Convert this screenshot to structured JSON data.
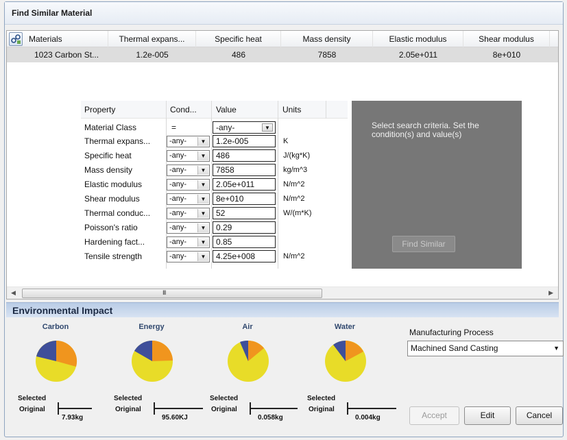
{
  "window": {
    "title": "Find Similar Material"
  },
  "grid": {
    "headers": [
      "Materials",
      "Thermal expans...",
      "Specific heat",
      "Mass density",
      "Elastic modulus",
      "Shear modulus"
    ],
    "row": [
      "1023 Carbon St...",
      "1.2e-005",
      "486",
      "7858",
      "2.05e+011",
      "8e+010"
    ]
  },
  "criteria": {
    "headers": {
      "property": "Property",
      "condition": "Cond...",
      "value": "Value",
      "units": "Units"
    },
    "material_class": {
      "name": "Material Class",
      "condition": "=",
      "value": "-any-"
    },
    "rows": [
      {
        "name": "Thermal expans...",
        "condition": "-any-",
        "value": "1.2e-005",
        "unit": "K"
      },
      {
        "name": "Specific heat",
        "condition": "-any-",
        "value": "486",
        "unit": "J/(kg*K)"
      },
      {
        "name": "Mass density",
        "condition": "-any-",
        "value": "7858",
        "unit": "kg/m^3"
      },
      {
        "name": "Elastic modulus",
        "condition": "-any-",
        "value": "2.05e+011",
        "unit": "N/m^2"
      },
      {
        "name": "Shear modulus",
        "condition": "-any-",
        "value": "8e+010",
        "unit": "N/m^2"
      },
      {
        "name": "Thermal conduc...",
        "condition": "-any-",
        "value": "52",
        "unit": "W/(m*K)"
      },
      {
        "name": "Poisson's ratio",
        "condition": "-any-",
        "value": "0.29",
        "unit": ""
      },
      {
        "name": "Hardening fact...",
        "condition": "-any-",
        "value": "0.85",
        "unit": ""
      },
      {
        "name": "Tensile strength",
        "condition": "-any-",
        "value": "4.25e+008",
        "unit": "N/m^2"
      }
    ],
    "hint": "Select search criteria. Set the condition(s) and value(s)",
    "find_button": "Find Similar",
    "scroll_grip": "III"
  },
  "environment": {
    "title": "Environmental Impact",
    "selected_label": "Selected",
    "original_label": "Original",
    "items": [
      {
        "name": "Carbon",
        "amount": "7.93kg"
      },
      {
        "name": "Energy",
        "amount": "95.60KJ"
      },
      {
        "name": "Air",
        "amount": "0.058kg"
      },
      {
        "name": "Water",
        "amount": "0.004kg"
      }
    ],
    "pie_colors": {
      "yellow": "#e8dc28",
      "orange": "#f0951e",
      "blue": "#3f4f9a"
    },
    "manufacturing_label": "Manufacturing Process",
    "manufacturing_value": "Machined Sand Casting"
  },
  "buttons": {
    "accept": "Accept",
    "edit": "Edit",
    "cancel": "Cancel"
  }
}
